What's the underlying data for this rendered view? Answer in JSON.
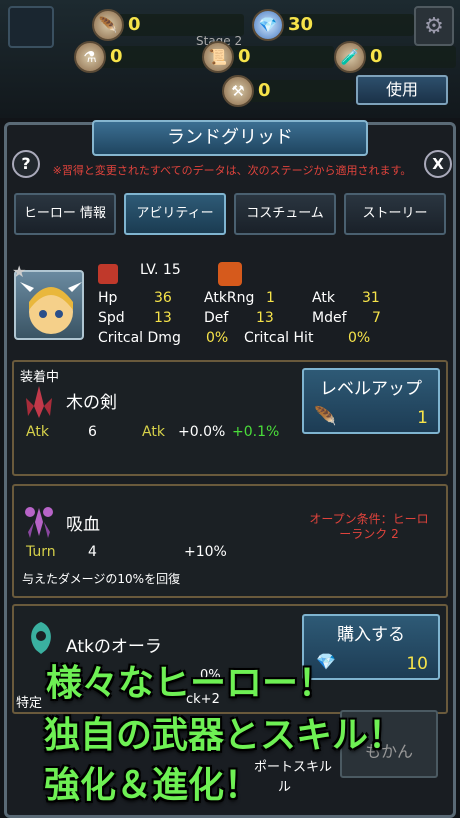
{
  "resources": [
    {
      "icon": "feather-quill-icon",
      "value": "0"
    },
    {
      "icon": "diamond-gem-icon",
      "value": "30"
    },
    {
      "icon": "potion-icon",
      "value": "0"
    },
    {
      "icon": "scroll-flask-icon",
      "value": "0"
    },
    {
      "icon": "green-potion-icon",
      "value": "0"
    },
    {
      "icon": "anvil-icon",
      "value": "0"
    }
  ],
  "stage_label": "Stage 2",
  "use_button": "使用",
  "panel": {
    "title": "ランドグリッド",
    "help": "?",
    "close": "X",
    "notice": "※習得と変更されたすべてのデータは、次のステージから適用されます。"
  },
  "tabs": [
    {
      "label": "ヒーロー 情報",
      "active": false
    },
    {
      "label": "アビリティー",
      "active": true
    },
    {
      "label": "コスチューム",
      "active": false
    },
    {
      "label": "ストーリー",
      "active": false
    }
  ],
  "hero": {
    "level": "LV. 15",
    "stats": {
      "hp_label": "Hp",
      "hp": "36",
      "atkrng_label": "AtkRng",
      "atkrng": "1",
      "atk_label": "Atk",
      "atk": "31",
      "spd_label": "Spd",
      "spd": "13",
      "def_label": "Def",
      "def": "13",
      "mdef_label": "Mdef",
      "mdef": "7",
      "critdmg_label": "Critcal Dmg",
      "critdmg": "0%",
      "crithit_label": "Critcal Hit",
      "crithit": "0%"
    }
  },
  "skills": {
    "equipped_label": "装着中",
    "weapon": {
      "name": "木の剣",
      "stat_label": "Atk",
      "stat_value": "6",
      "bonus_label": "Atk",
      "bonus_value": "+0.0%",
      "bonus_extra": "+0.1%",
      "action_label": "レベルアップ",
      "action_count": "1"
    },
    "drain": {
      "name": "吸血",
      "stat_label": "Turn",
      "stat_value": "4",
      "bonus_value": "+10%",
      "description": "与えたダメージの10%を回復",
      "open_condition": "オープン条件：ヒーローランク 2"
    },
    "aura": {
      "name": "Atkのオーラ",
      "action_label": "購入する",
      "action_count": "10",
      "partial_1": "0%",
      "partial_2": "特定",
      "partial_3": "ck+2",
      "partial_4": "ポートスキル",
      "partial_5": "ル",
      "partial_6": "もかん"
    }
  },
  "promo": {
    "line1": "様々なヒーロー！",
    "line2": "独自の武器とスキル！",
    "line3": "強化＆進化！"
  }
}
